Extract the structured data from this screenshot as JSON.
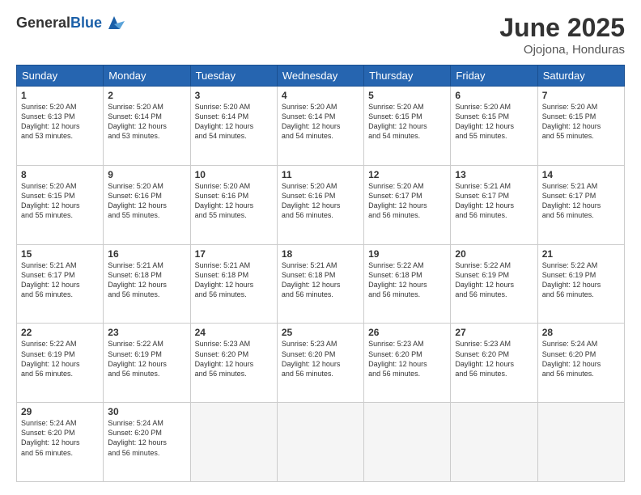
{
  "header": {
    "logo_line1": "General",
    "logo_line2": "Blue",
    "title": "June 2025",
    "location": "Ojojona, Honduras"
  },
  "weekdays": [
    "Sunday",
    "Monday",
    "Tuesday",
    "Wednesday",
    "Thursday",
    "Friday",
    "Saturday"
  ],
  "weeks": [
    [
      {
        "day": "1",
        "info": "Sunrise: 5:20 AM\nSunset: 6:13 PM\nDaylight: 12 hours\nand 53 minutes."
      },
      {
        "day": "2",
        "info": "Sunrise: 5:20 AM\nSunset: 6:14 PM\nDaylight: 12 hours\nand 53 minutes."
      },
      {
        "day": "3",
        "info": "Sunrise: 5:20 AM\nSunset: 6:14 PM\nDaylight: 12 hours\nand 54 minutes."
      },
      {
        "day": "4",
        "info": "Sunrise: 5:20 AM\nSunset: 6:14 PM\nDaylight: 12 hours\nand 54 minutes."
      },
      {
        "day": "5",
        "info": "Sunrise: 5:20 AM\nSunset: 6:15 PM\nDaylight: 12 hours\nand 54 minutes."
      },
      {
        "day": "6",
        "info": "Sunrise: 5:20 AM\nSunset: 6:15 PM\nDaylight: 12 hours\nand 55 minutes."
      },
      {
        "day": "7",
        "info": "Sunrise: 5:20 AM\nSunset: 6:15 PM\nDaylight: 12 hours\nand 55 minutes."
      }
    ],
    [
      {
        "day": "8",
        "info": "Sunrise: 5:20 AM\nSunset: 6:15 PM\nDaylight: 12 hours\nand 55 minutes."
      },
      {
        "day": "9",
        "info": "Sunrise: 5:20 AM\nSunset: 6:16 PM\nDaylight: 12 hours\nand 55 minutes."
      },
      {
        "day": "10",
        "info": "Sunrise: 5:20 AM\nSunset: 6:16 PM\nDaylight: 12 hours\nand 55 minutes."
      },
      {
        "day": "11",
        "info": "Sunrise: 5:20 AM\nSunset: 6:16 PM\nDaylight: 12 hours\nand 56 minutes."
      },
      {
        "day": "12",
        "info": "Sunrise: 5:20 AM\nSunset: 6:17 PM\nDaylight: 12 hours\nand 56 minutes."
      },
      {
        "day": "13",
        "info": "Sunrise: 5:21 AM\nSunset: 6:17 PM\nDaylight: 12 hours\nand 56 minutes."
      },
      {
        "day": "14",
        "info": "Sunrise: 5:21 AM\nSunset: 6:17 PM\nDaylight: 12 hours\nand 56 minutes."
      }
    ],
    [
      {
        "day": "15",
        "info": "Sunrise: 5:21 AM\nSunset: 6:17 PM\nDaylight: 12 hours\nand 56 minutes."
      },
      {
        "day": "16",
        "info": "Sunrise: 5:21 AM\nSunset: 6:18 PM\nDaylight: 12 hours\nand 56 minutes."
      },
      {
        "day": "17",
        "info": "Sunrise: 5:21 AM\nSunset: 6:18 PM\nDaylight: 12 hours\nand 56 minutes."
      },
      {
        "day": "18",
        "info": "Sunrise: 5:21 AM\nSunset: 6:18 PM\nDaylight: 12 hours\nand 56 minutes."
      },
      {
        "day": "19",
        "info": "Sunrise: 5:22 AM\nSunset: 6:18 PM\nDaylight: 12 hours\nand 56 minutes."
      },
      {
        "day": "20",
        "info": "Sunrise: 5:22 AM\nSunset: 6:19 PM\nDaylight: 12 hours\nand 56 minutes."
      },
      {
        "day": "21",
        "info": "Sunrise: 5:22 AM\nSunset: 6:19 PM\nDaylight: 12 hours\nand 56 minutes."
      }
    ],
    [
      {
        "day": "22",
        "info": "Sunrise: 5:22 AM\nSunset: 6:19 PM\nDaylight: 12 hours\nand 56 minutes."
      },
      {
        "day": "23",
        "info": "Sunrise: 5:22 AM\nSunset: 6:19 PM\nDaylight: 12 hours\nand 56 minutes."
      },
      {
        "day": "24",
        "info": "Sunrise: 5:23 AM\nSunset: 6:20 PM\nDaylight: 12 hours\nand 56 minutes."
      },
      {
        "day": "25",
        "info": "Sunrise: 5:23 AM\nSunset: 6:20 PM\nDaylight: 12 hours\nand 56 minutes."
      },
      {
        "day": "26",
        "info": "Sunrise: 5:23 AM\nSunset: 6:20 PM\nDaylight: 12 hours\nand 56 minutes."
      },
      {
        "day": "27",
        "info": "Sunrise: 5:23 AM\nSunset: 6:20 PM\nDaylight: 12 hours\nand 56 minutes."
      },
      {
        "day": "28",
        "info": "Sunrise: 5:24 AM\nSunset: 6:20 PM\nDaylight: 12 hours\nand 56 minutes."
      }
    ],
    [
      {
        "day": "29",
        "info": "Sunrise: 5:24 AM\nSunset: 6:20 PM\nDaylight: 12 hours\nand 56 minutes."
      },
      {
        "day": "30",
        "info": "Sunrise: 5:24 AM\nSunset: 6:20 PM\nDaylight: 12 hours\nand 56 minutes."
      },
      {
        "day": "",
        "info": ""
      },
      {
        "day": "",
        "info": ""
      },
      {
        "day": "",
        "info": ""
      },
      {
        "day": "",
        "info": ""
      },
      {
        "day": "",
        "info": ""
      }
    ]
  ]
}
